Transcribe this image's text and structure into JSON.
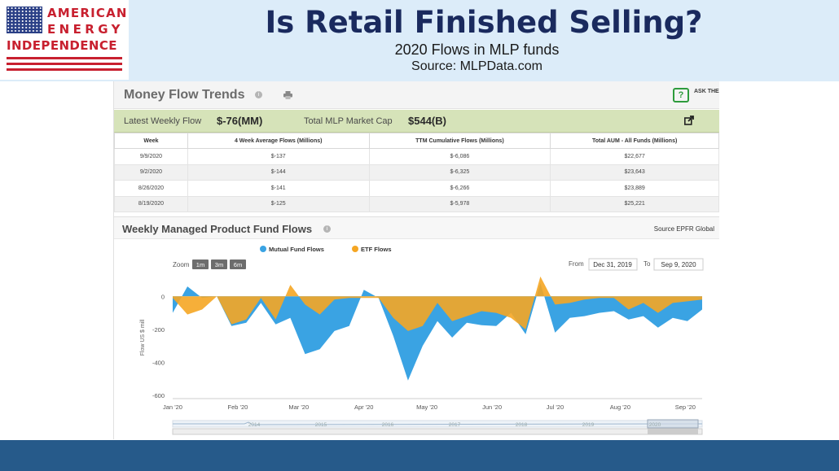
{
  "slide": {
    "title": "Is Retail Finished Selling?",
    "subtitle": "2020 Flows in MLP funds",
    "source": "Source: MLPData.com"
  },
  "logo": {
    "line1": "AMERICAN",
    "line2": "ENERGY",
    "line3": "INDEPENDENCE"
  },
  "colors": {
    "title": "#1a2a5e",
    "logo_red": "#c8202f",
    "header_band": "#dcecf9",
    "footer_band": "#265a8a",
    "mutual": "#3aa3e3",
    "etf": "#f5a623",
    "summary_bar": "#d6e3b9"
  },
  "money_flow": {
    "title": "Money Flow Trends",
    "ask_expert": "ASK THE EXPERT",
    "latest_weekly_label": "Latest Weekly Flow",
    "latest_weekly_value": "$-76(MM)",
    "market_cap_label": "Total MLP Market Cap",
    "market_cap_value": "$544(B)",
    "icons": [
      "info-icon",
      "print-icon",
      "ask-expert-icon",
      "external-link-icon"
    ]
  },
  "flows_table": {
    "columns": [
      "Week",
      "4 Week Average Flows (Millions)",
      "TTM Cumulative Flows (Millions)",
      "Total AUM - All Funds (Millions)"
    ],
    "rows": [
      [
        "9/9/2020",
        "$-137",
        "$-6,086",
        "$22,677"
      ],
      [
        "9/2/2020",
        "$-144",
        "$-6,325",
        "$23,643"
      ],
      [
        "8/26/2020",
        "$-141",
        "$-6,266",
        "$23,889"
      ],
      [
        "8/19/2020",
        "$-125",
        "$-5,978",
        "$25,221"
      ]
    ]
  },
  "weekly_flows": {
    "title": "Weekly Managed Product Fund Flows",
    "source": "Source  EPFR Global",
    "zoom_label": "Zoom",
    "zoom_buttons": [
      "1m",
      "3m",
      "6m"
    ],
    "from_label": "From",
    "from_value": "Dec 31, 2019",
    "to_label": "To",
    "to_value": "Sep 9, 2020",
    "navigator_years": [
      "2014",
      "2015",
      "2016",
      "2017",
      "2018",
      "2019",
      "2020"
    ]
  },
  "chart_data": {
    "type": "area",
    "title": "",
    "xlabel": "",
    "ylabel": "Flow US $ mill",
    "ylim": [
      -600,
      100
    ],
    "yticks": [
      0,
      -200,
      -400,
      -600
    ],
    "x_tick_labels": [
      "Jan '20",
      "Feb '20",
      "Mar '20",
      "Apr '20",
      "May '20",
      "Jun '20",
      "Jul '20",
      "Aug '20",
      "Sep '20"
    ],
    "legend_position": "top",
    "grid": false,
    "x": [
      "2020-01-01",
      "2020-01-08",
      "2020-01-15",
      "2020-01-22",
      "2020-01-29",
      "2020-02-05",
      "2020-02-12",
      "2020-02-19",
      "2020-02-26",
      "2020-03-04",
      "2020-03-11",
      "2020-03-18",
      "2020-03-25",
      "2020-04-01",
      "2020-04-08",
      "2020-04-15",
      "2020-04-22",
      "2020-04-29",
      "2020-05-06",
      "2020-05-13",
      "2020-05-20",
      "2020-05-27",
      "2020-06-03",
      "2020-06-10",
      "2020-06-17",
      "2020-06-24",
      "2020-07-01",
      "2020-07-08",
      "2020-07-15",
      "2020-07-22",
      "2020-07-29",
      "2020-08-05",
      "2020-08-12",
      "2020-08-19",
      "2020-08-26",
      "2020-09-02",
      "2020-09-09"
    ],
    "series": [
      {
        "name": "Mutual Fund Flows",
        "values": [
          -100,
          60,
          -10,
          0,
          -180,
          -160,
          -40,
          -170,
          -130,
          -350,
          -320,
          -210,
          -180,
          40,
          -10,
          -240,
          -510,
          -300,
          -150,
          -250,
          -160,
          -175,
          -180,
          -100,
          -230,
          80,
          -220,
          -130,
          -120,
          -100,
          -90,
          -140,
          -120,
          -190,
          -130,
          -150,
          -80
        ]
      },
      {
        "name": "ETF Flows",
        "values": [
          -10,
          -110,
          -80,
          0,
          -170,
          -140,
          -10,
          -140,
          70,
          -50,
          -110,
          -20,
          -10,
          -10,
          -10,
          -130,
          -210,
          -180,
          -40,
          -150,
          -120,
          -90,
          -100,
          -130,
          -200,
          120,
          -50,
          -40,
          -20,
          -10,
          -10,
          -80,
          -40,
          -100,
          -40,
          -30,
          -20
        ]
      }
    ]
  }
}
